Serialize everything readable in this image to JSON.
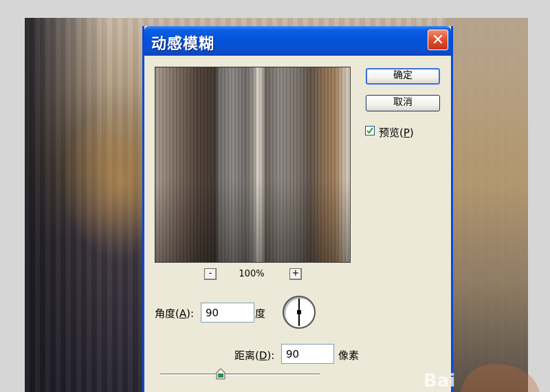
{
  "dialog": {
    "title": "动感模糊",
    "close_glyph": "✕",
    "ok_label": "确定",
    "cancel_label": "取消",
    "preview_checkbox": {
      "label": "预览",
      "accel_open": "(",
      "accel_key": "P",
      "accel_close": ")",
      "checked": true
    },
    "zoom": {
      "minus": "-",
      "plus": "+",
      "value": "100%"
    },
    "angle": {
      "label": "角度",
      "accel_open": "(",
      "accel_key": "A",
      "accel_close": "):",
      "value": "90",
      "unit": "度"
    },
    "distance": {
      "label": "距离",
      "accel_open": "(",
      "accel_key": "D",
      "accel_close": "):",
      "value": "90",
      "unit": "像素",
      "slider_fraction": 0.38
    }
  },
  "watermark": {
    "text": "Bai"
  },
  "colors": {
    "titlebar": "#0453db",
    "dialog_bg": "#ece9d8",
    "close": "#dd4a2a",
    "checkmark": "#21a121",
    "slider_thumb": "#2e8b57"
  }
}
